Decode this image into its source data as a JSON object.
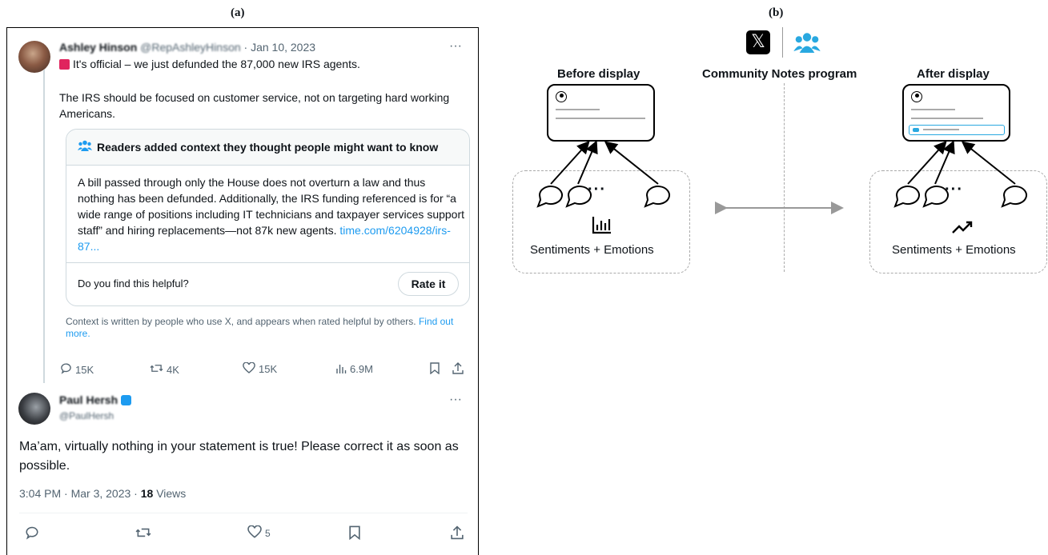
{
  "captions": {
    "a": "(a)",
    "b": "(b)"
  },
  "tweet": {
    "author_name": "Ashley Hinson",
    "author_handle": "@RepAshleyHinson",
    "date": "· Jan 10, 2023",
    "more": "···",
    "line1": "It's official – we just defunded the 87,000 new IRS agents.",
    "line2": "The IRS should be focused on customer service, not on targeting hard working Americans.",
    "note_title": "Readers added context they thought people might want to know",
    "note_body": "A bill passed through only the House does not overturn a law and thus nothing has been defunded. Additionally, the IRS funding referenced is for “a wide range of positions including IT technicians and taxpayer services support staff” and hiring replacements—not 87k new agents.",
    "note_link": "time.com/6204928/irs-87...",
    "helpful_q": "Do you find this helpful?",
    "rate_button": "Rate it",
    "context_info": "Context is written by people who use X, and appears when rated helpful by others.",
    "find_out": "Find out more.",
    "replies": "15K",
    "reposts": "4K",
    "likes": "15K",
    "views": "6.9M"
  },
  "reply": {
    "author_name": "Paul Hersh",
    "author_handle": "@PaulHersh",
    "more": "···",
    "text": "Ma’am, virtually nothing in your statement is true!  Please correct it as soon as possible.",
    "timestamp": "3:04 PM · Mar 3, 2023 · ",
    "views_count": "18",
    "views_label": " Views",
    "likes": "5"
  },
  "diagram": {
    "before_label": "Before display",
    "program_label": "Community Notes program",
    "after_label": "After display",
    "ellipsis": "···",
    "left_caption": "Sentiments + Emotions",
    "right_caption": "Sentiments + Emotions",
    "x_logo": "𝕏",
    "accent": "#29a8e0"
  }
}
